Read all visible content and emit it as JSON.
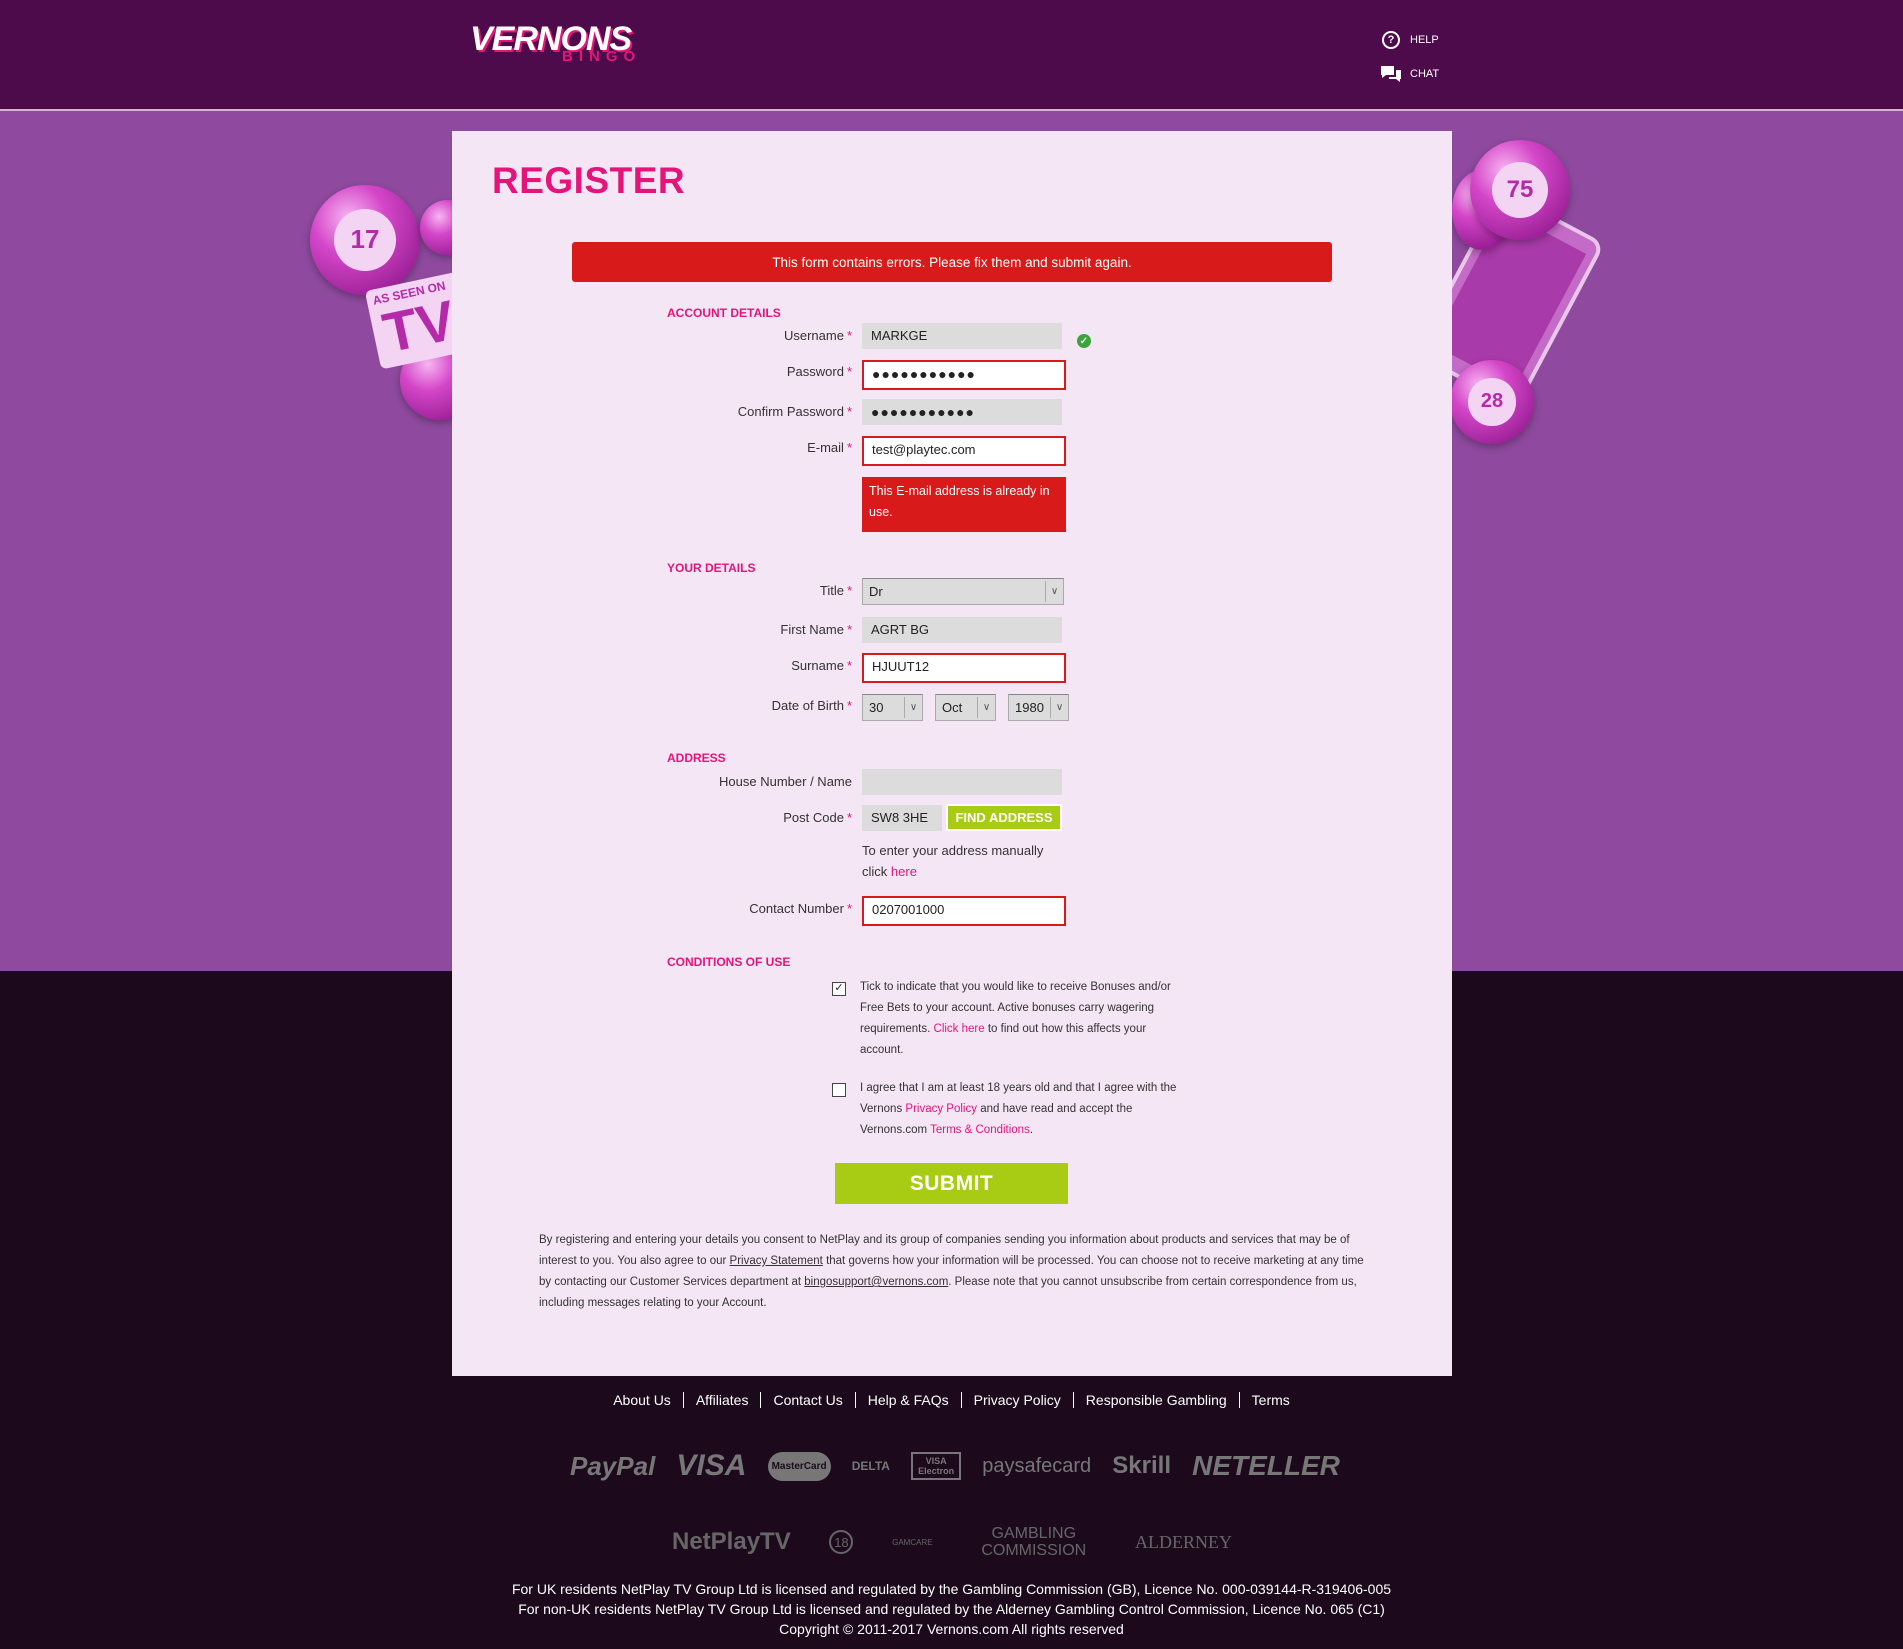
{
  "header": {
    "logo_main": "VERNONS",
    "logo_sub": "BINGO",
    "help_label": "HELP",
    "chat_label": "CHAT"
  },
  "decor": {
    "ball_left_1": "17",
    "ball_right_1": "75",
    "ball_right_2": "28",
    "tv_small": "AS SEEN ON",
    "tv_big": "TV"
  },
  "page_title": "REGISTER",
  "error_banner": "This form contains errors. Please fix them and submit again.",
  "account": {
    "heading": "ACCOUNT DETAILS",
    "username_label": "Username",
    "username_value": "MARKGE",
    "password_label": "Password",
    "password_value": "●●●●●●●●●●●",
    "confirm_label": "Confirm Password",
    "confirm_value": "●●●●●●●●●●●",
    "email_label": "E-mail",
    "email_value": "test@playtec.com",
    "email_error": "This E-mail address is already in use."
  },
  "details": {
    "heading": "YOUR DETAILS",
    "title_label": "Title",
    "title_value": "Dr",
    "first_label": "First Name",
    "first_value": "AGRT BG",
    "surname_label": "Surname",
    "surname_value": "HJUUT12",
    "dob_label": "Date of Birth",
    "dob_day": "30",
    "dob_month": "Oct",
    "dob_year": "1980"
  },
  "address": {
    "heading": "ADDRESS",
    "house_label": "House Number / Name",
    "house_value": "",
    "postcode_label": "Post Code",
    "postcode_value": "SW8 3HE",
    "find_button": "FIND ADDRESS",
    "manual_text": "To enter your address manually click",
    "manual_link": "here",
    "contact_label": "Contact Number",
    "contact_value": "0207001000"
  },
  "conditions": {
    "heading": "CONDITIONS OF USE",
    "bonus_text_1": "Tick to indicate that you would like to receive Bonuses and/or Free Bets to your account. Active bonuses carry wagering requirements.",
    "bonus_link": "Click here",
    "bonus_text_2": "to find out how this affects your account.",
    "bonus_checked": "✓",
    "age_text_1": "I agree that I am at least 18 years old and that I agree with the Vernons",
    "privacy_link": "Privacy Policy",
    "age_text_2": "and have read and accept the Vernons.com",
    "terms_link": "Terms & Conditions",
    "age_text_3": "."
  },
  "submit_label": "SUBMIT",
  "consent": {
    "part1": "By registering and entering your details you consent to NetPlay and its group of companies sending you information about products and services that may be of interest to you. You also agree to our",
    "privacy_statement": "Privacy Statement",
    "part2": "that governs how your information will be processed. You can choose not to receive marketing at any time by contacting our Customer Services department at",
    "email": "bingosupport@vernons.com",
    "part3": ". Please note that you cannot unsubscribe from certain correspondence from us, including messages relating to your Account."
  },
  "footer": {
    "links": [
      "About Us",
      "Affiliates",
      "Contact Us",
      "Help & FAQs",
      "Privacy Policy",
      "Responsible Gambling",
      "Terms"
    ],
    "payments": [
      "PayPal",
      "VISA",
      "MasterCard",
      "DELTA",
      "VISA Electron",
      "paysafecard",
      "Skrill",
      "NETELLER"
    ],
    "regulators": [
      "NetPlayTV",
      "18",
      "GAMCARE",
      "GAMBLING COMMISSION",
      "ALDERNEY"
    ],
    "legal_1": "For UK residents NetPlay TV Group Ltd is licensed and regulated by the Gambling Commission (GB), Licence No. 000-039144-R-319406-005",
    "legal_2": "For non-UK residents NetPlay TV Group Ltd is licensed and regulated by the Alderney Gambling Control Commission, Licence No. 065 (C1)",
    "legal_3": "Copyright © 2011-2017 Vernons.com All rights reserved"
  },
  "colors": {
    "header_bg": "#4e0b4b",
    "band_bg": "#8f4a9f",
    "accent_pink": "#e4157a",
    "error_red": "#d91a1a",
    "submit_green": "#a8cc14"
  }
}
